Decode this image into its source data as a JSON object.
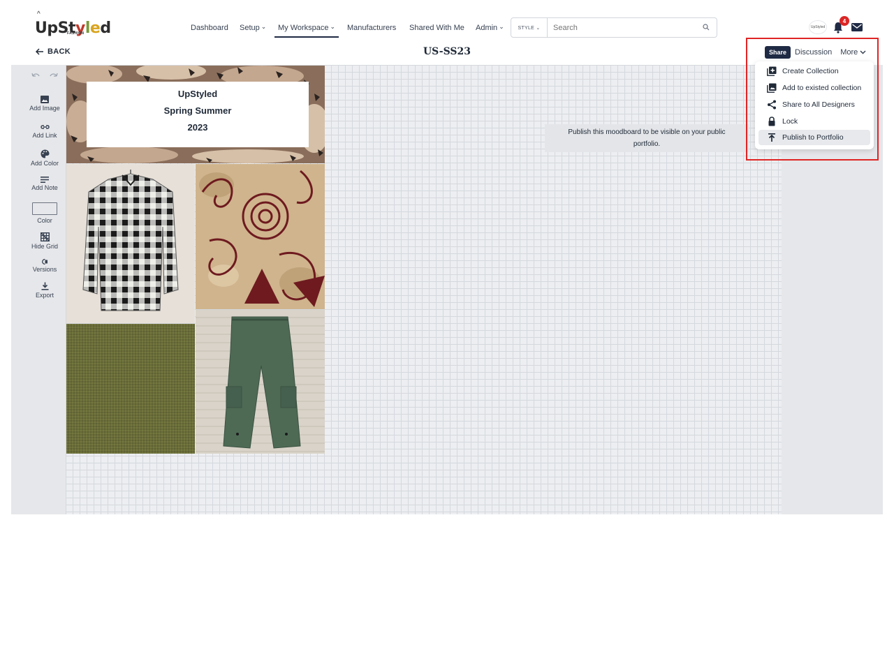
{
  "app": {
    "logo_text": "UpStyled",
    "logo_sub": "FASHION"
  },
  "nav": {
    "items": [
      {
        "label": "Dashboard",
        "has_caret": false
      },
      {
        "label": "Setup",
        "has_caret": true
      },
      {
        "label": "My Workspace",
        "has_caret": true,
        "active": true
      },
      {
        "label": "Manufacturers",
        "has_caret": false
      },
      {
        "label": "Shared With Me",
        "has_caret": false
      },
      {
        "label": "Admin",
        "has_caret": true
      }
    ],
    "search_type": "STYLE ⌄",
    "search_placeholder": "Search",
    "notification_count": "4",
    "avatar_text": "UpStyled"
  },
  "subheader": {
    "back_label": "BACK",
    "board_title": "US-SS23",
    "tab_share": "Share",
    "tab_discussion": "Discussion",
    "tab_more": "More"
  },
  "toolbar": {
    "items": [
      {
        "label": "Add Image",
        "icon": "image-icon"
      },
      {
        "label": "Add Link",
        "icon": "link-icon"
      },
      {
        "label": "Add Color",
        "icon": "palette-icon"
      },
      {
        "label": "Add Note",
        "icon": "note-icon"
      },
      {
        "label": "Color",
        "icon": "color-swatch-icon"
      },
      {
        "label": "Hide Grid",
        "icon": "grid-icon"
      },
      {
        "label": "Versions",
        "icon": "versions-icon"
      },
      {
        "label": "Export",
        "icon": "download-icon"
      }
    ]
  },
  "moodboard": {
    "title_lines": [
      "UpStyled",
      "Spring Summer",
      "2023"
    ]
  },
  "tooltip": {
    "text_line1": "Publish this moodboard to be visible on your public",
    "text_line2": "portfolio."
  },
  "dropdown": {
    "items": [
      {
        "label": "Create Collection",
        "icon": "create-collection-icon"
      },
      {
        "label": "Add to existed collection",
        "icon": "add-collection-icon"
      },
      {
        "label": "Share to All Designers",
        "icon": "share-icon"
      },
      {
        "label": "Lock",
        "icon": "lock-icon"
      },
      {
        "label": "Publish to Portfolio",
        "icon": "publish-icon",
        "highlighted": true
      }
    ]
  },
  "colors": {
    "accent_dark": "#1f2a44",
    "highlight_border": "#e02424",
    "badge": "#dc2626"
  }
}
